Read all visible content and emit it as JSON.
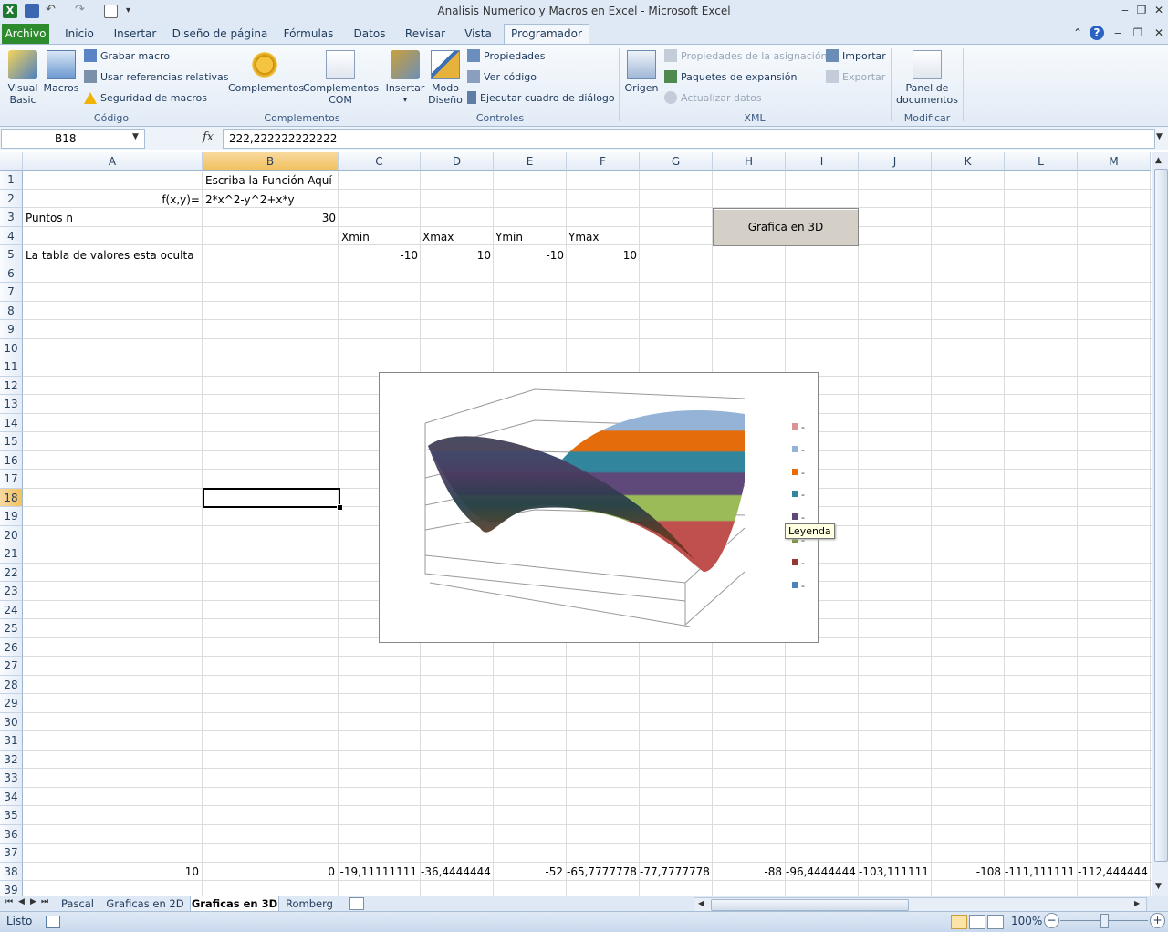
{
  "window": {
    "title": "Analisis Numerico y Macros en Excel  -  Microsoft Excel"
  },
  "tabs": [
    {
      "label": "Archivo"
    },
    {
      "label": "Inicio"
    },
    {
      "label": "Insertar"
    },
    {
      "label": "Diseño de página"
    },
    {
      "label": "Fórmulas"
    },
    {
      "label": "Datos"
    },
    {
      "label": "Revisar"
    },
    {
      "label": "Vista"
    },
    {
      "label": "Programador"
    }
  ],
  "ribbon": {
    "groups": {
      "codigo": "Código",
      "complementos": "Complementos",
      "controles": "Controles",
      "xml": "XML",
      "modificar": "Modificar"
    },
    "visual_basic_1": "Visual",
    "visual_basic_2": "Basic",
    "macros": "Macros",
    "grabar_macro": "Grabar macro",
    "usar_referencias": "Usar referencias relativas",
    "seguridad_macros": "Seguridad de macros",
    "complementos": "Complementos",
    "complementos_com_1": "Complementos",
    "complementos_com_2": "COM",
    "insertar": "Insertar",
    "modo_diseno_1": "Modo",
    "modo_diseno_2": "Diseño",
    "propiedades": "Propiedades",
    "ver_codigo": "Ver código",
    "ejecutar_cuadro": "Ejecutar cuadro de diálogo",
    "origen": "Origen",
    "propiedades_asignacion": "Propiedades de la asignación",
    "paquetes_expansion": "Paquetes de expansión",
    "actualizar_datos": "Actualizar datos",
    "importar": "Importar",
    "exportar": "Exportar",
    "panel_documentos_1": "Panel de",
    "panel_documentos_2": "documentos"
  },
  "formula_bar": {
    "name_box": "B18",
    "fx": "fx",
    "value": "222,222222222222"
  },
  "columns": [
    "A",
    "B",
    "C",
    "D",
    "E",
    "F",
    "G",
    "H",
    "I",
    "J",
    "K",
    "L",
    "M"
  ],
  "rows": [
    "1",
    "2",
    "3",
    "4",
    "5",
    "6",
    "7",
    "8",
    "9",
    "10",
    "11",
    "12",
    "13",
    "14",
    "15",
    "16",
    "17",
    "18",
    "19",
    "20",
    "21",
    "22",
    "23",
    "24",
    "25",
    "26",
    "27",
    "28",
    "29",
    "30",
    "31",
    "32",
    "33",
    "34",
    "35",
    "36",
    "37",
    "38",
    "39"
  ],
  "cells": {
    "B1": "Escriba la Función Aquí",
    "A2": "f(x,y)=",
    "B2": "2*x^2-y^2+x*y",
    "A3": "Puntos n",
    "B3": "30",
    "C4": "Xmin",
    "D4": "Xmax",
    "E4": "Ymin",
    "F4": "Ymax",
    "A5": "La tabla de valores esta  oculta",
    "C5": "-10",
    "D5": "10",
    "E5": "-10",
    "F5": "10",
    "row38": [
      "10",
      "0",
      "-19,11111111",
      "-36,4444444",
      "-52",
      "-65,7777778",
      "-77,7777778",
      "-88",
      "-96,4444444",
      "-103,111111",
      "-108",
      "-111,111111",
      "-112,444444"
    ]
  },
  "macro_button": {
    "label": "Grafica en 3D"
  },
  "chart": {
    "tooltip": "Leyenda",
    "legend_marker": "-",
    "legend_colors": [
      "#d99594",
      "#95b3d7",
      "#e46c0a",
      "#31859c",
      "#5f497a",
      "#77933c",
      "#953735",
      "#4f81bd"
    ]
  },
  "sheet_tabs": [
    {
      "label": "Pascal"
    },
    {
      "label": "Graficas en 2D"
    },
    {
      "label": "Graficas en 3D"
    },
    {
      "label": "Romberg"
    }
  ],
  "status": {
    "ready": "Listo",
    "zoom": "100%"
  }
}
